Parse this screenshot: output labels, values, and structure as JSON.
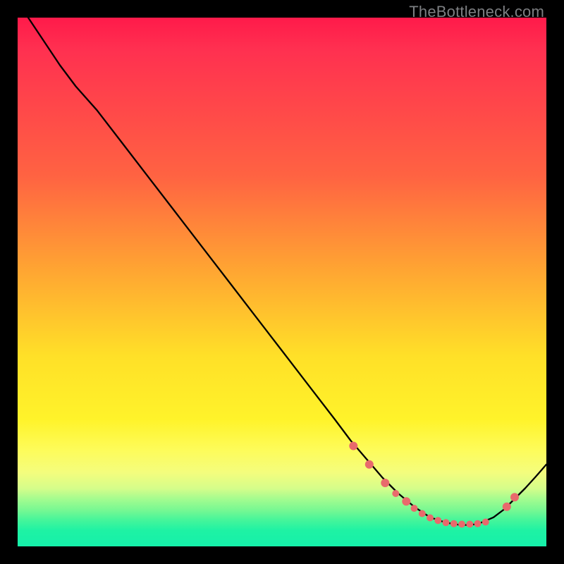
{
  "watermark": "TheBottleneck.com",
  "colors": {
    "background": "#000000",
    "gradient_top": "#ff1a4a",
    "gradient_mid": "#ffe028",
    "gradient_bottom": "#15f0aa",
    "line": "#000000",
    "marker": "#e86a6c"
  },
  "chart_data": {
    "type": "line",
    "title": "",
    "xlabel": "",
    "ylabel": "",
    "xlim": [
      0,
      100
    ],
    "ylim": [
      0,
      100
    ],
    "note": "Axes are unlabeled in the image; x and y are normalized 0–100 estimates read from pixel positions. y increases upward (top of plot = 100, bottom = 0). The curve descends steeply from top-left, flattens near the bottom around x≈75–88, then rises toward the right edge.",
    "series": [
      {
        "name": "curve",
        "x": [
          2,
          4,
          6,
          8,
          11,
          15,
          20,
          25,
          30,
          35,
          40,
          45,
          50,
          55,
          60,
          63,
          66,
          69,
          72,
          75,
          78,
          81,
          84,
          87,
          90,
          92,
          94,
          96,
          98,
          100
        ],
        "y": [
          100,
          97,
          94,
          91,
          87,
          82.5,
          76,
          69.5,
          63,
          56.5,
          50,
          43.5,
          37,
          30.5,
          24,
          20,
          16.5,
          13,
          10,
          7.5,
          5.5,
          4.5,
          4,
          4.2,
          5.5,
          7,
          9,
          11,
          13.2,
          15.5
        ]
      }
    ],
    "markers": {
      "note": "Salmon circular markers clustered along the trough and start of the right-side rise.",
      "x": [
        63.5,
        66.5,
        69.5,
        71.5,
        73.5,
        75.0,
        76.5,
        78.0,
        79.5,
        81.0,
        82.5,
        84.0,
        85.5,
        87.0,
        88.5,
        92.5,
        94.0
      ],
      "y": [
        19.0,
        15.5,
        12.0,
        10.0,
        8.5,
        7.2,
        6.2,
        5.4,
        4.9,
        4.5,
        4.3,
        4.2,
        4.2,
        4.3,
        4.6,
        7.5,
        9.3
      ],
      "r": [
        6,
        6,
        6,
        5,
        6,
        5,
        5,
        5,
        5,
        5,
        5,
        5,
        5,
        5,
        5,
        6,
        6
      ]
    }
  }
}
